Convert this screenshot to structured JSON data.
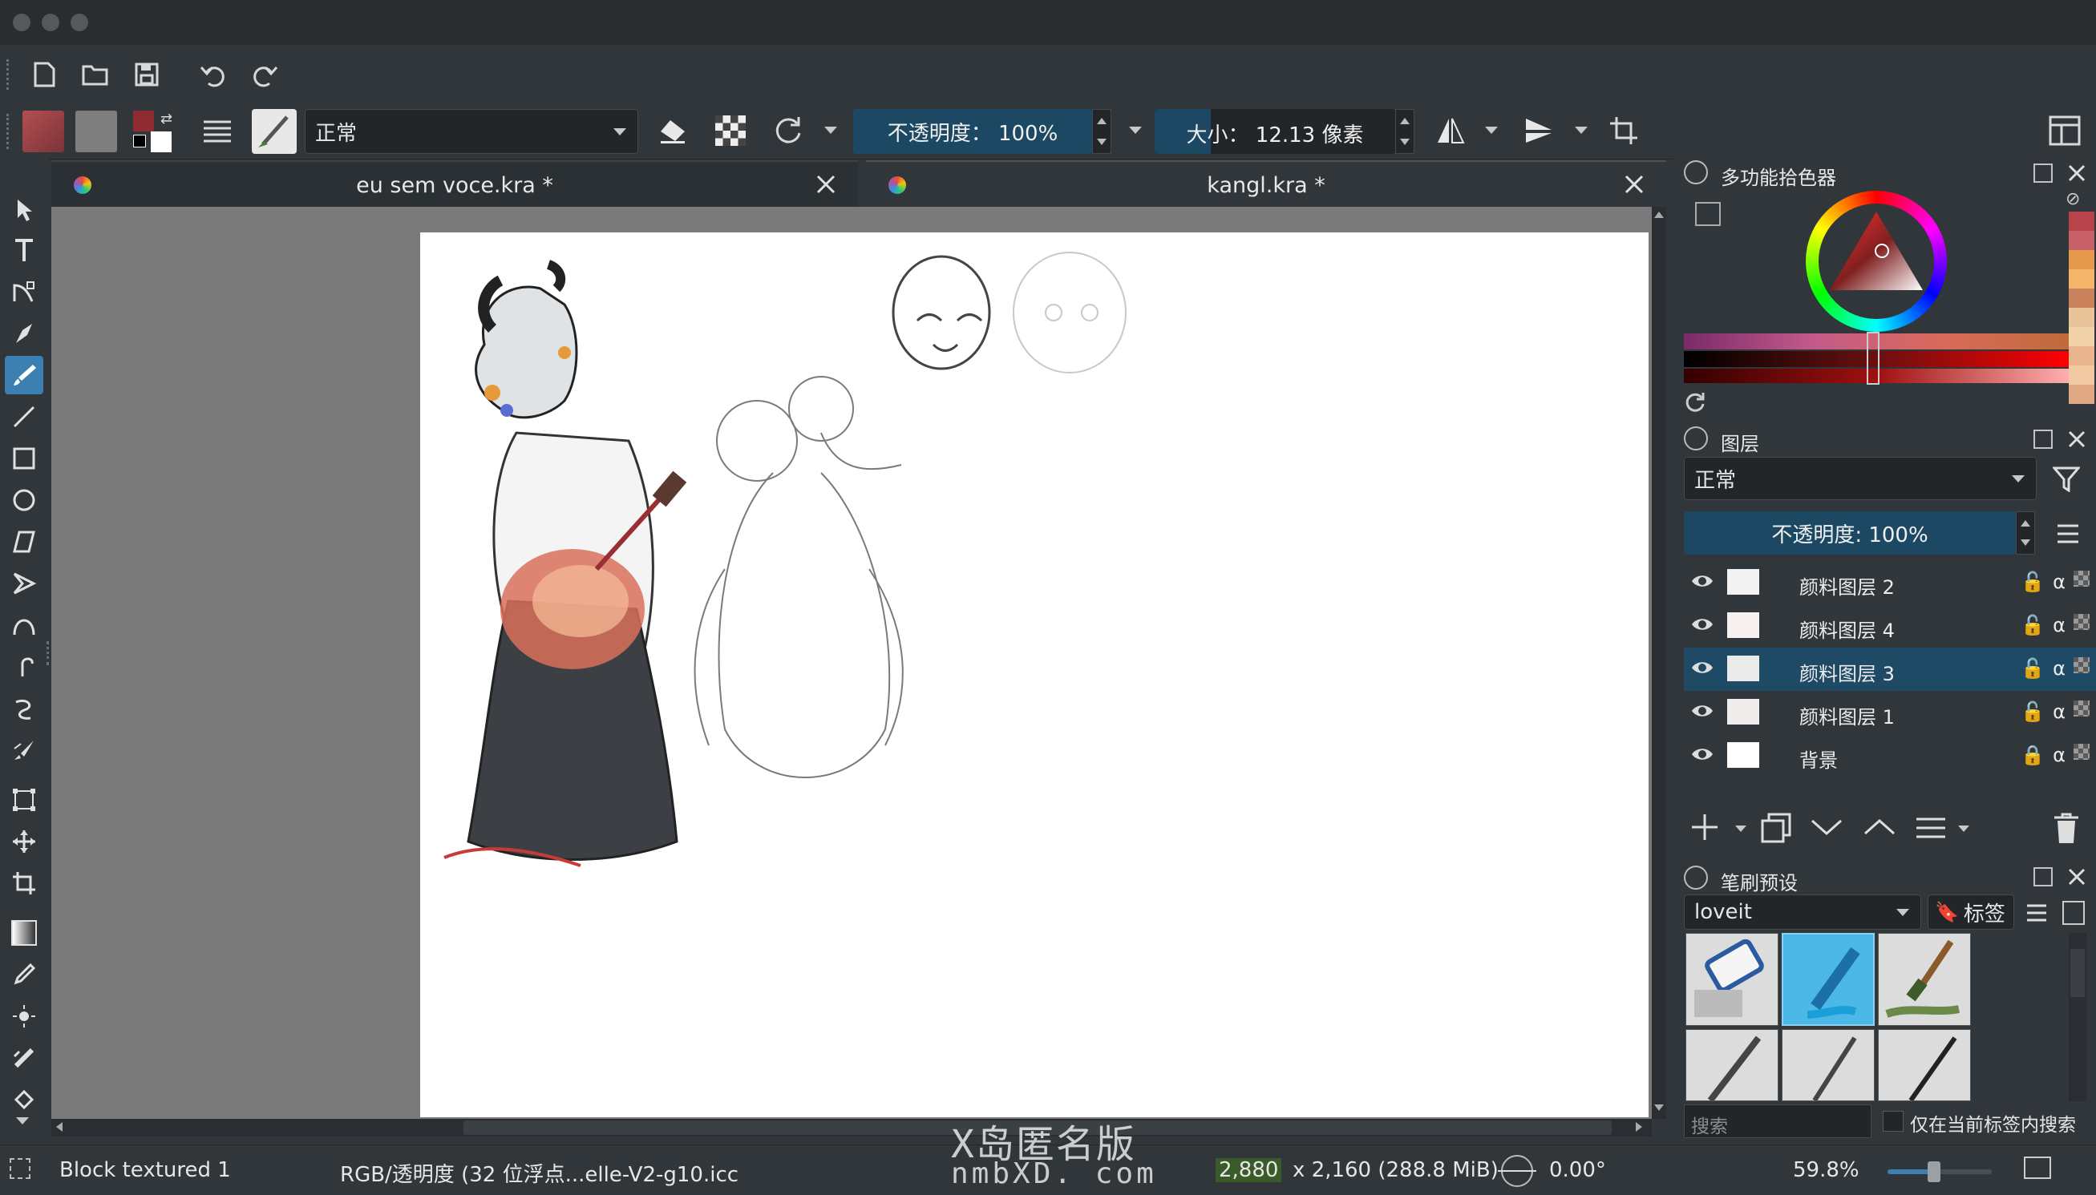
{
  "window": {
    "traffic_lights": [
      "close",
      "minimize",
      "zoom"
    ]
  },
  "toolbar": {
    "blend_mode": "正常",
    "opacity_label": "不透明度： 100%",
    "size_label": "大小： 12.13 像素"
  },
  "tabs": [
    {
      "title": "eu sem voce.kra *"
    },
    {
      "title": "kangl.kra *"
    }
  ],
  "tools": [
    "select-icon",
    "text-icon",
    "shape-edit-icon",
    "calligraphy-icon",
    "freehand-brush-icon",
    "line-icon",
    "rectangle-icon",
    "ellipse-icon",
    "polygon-icon",
    "polyline-icon",
    "bezier-icon",
    "freehand-path-icon",
    "dynamic-brush-icon",
    "multibrush-icon",
    "transform-icon",
    "move-icon",
    "crop-icon",
    "gradient-icon",
    "color-picker-icon",
    "smart-patch-icon",
    "assistant-icon",
    "fill-icon"
  ],
  "color_selector": {
    "title": "多功能拾色器",
    "history_colors": [
      "#b8444b",
      "#c8606a",
      "#e49a4a",
      "#f2b56a",
      "#c9825c",
      "#e9c39a",
      "#f2d2a8",
      "#e8b58f",
      "#f0c8a2",
      "#dfa882"
    ]
  },
  "layers": {
    "title": "图层",
    "blend_mode": "正常",
    "opacity_label": "不透明度:  100%",
    "items": [
      {
        "name": "颜料图层 2",
        "selected": false,
        "locked": false
      },
      {
        "name": "颜料图层 4",
        "selected": false,
        "locked": false
      },
      {
        "name": "颜料图层 3",
        "selected": true,
        "locked": false
      },
      {
        "name": "颜料图层 1",
        "selected": false,
        "locked": false
      },
      {
        "name": "背景",
        "selected": false,
        "locked": true
      }
    ]
  },
  "brush_presets": {
    "title": "笔刷预设",
    "set_name": "loveit",
    "tag_label": "标签",
    "search_placeholder": "搜索",
    "filter_checkbox_label": "仅在当前标签内搜索"
  },
  "status": {
    "brush_name": "Block textured 1",
    "color_profile": "RGB/透明度 (32 位浮点...elle-V2-g10.icc",
    "dimensions_w": "2,880",
    "dimensions_rest": "x 2,160 (288.8 MiB)",
    "rotation": "0.00°",
    "zoom": "59.8%"
  },
  "watermark": {
    "line1": "X岛匿名版",
    "line2": "nmbXD. com"
  }
}
